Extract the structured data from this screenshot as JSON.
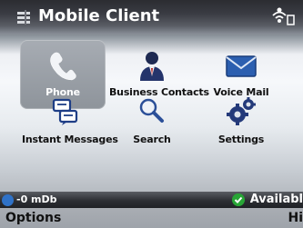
{
  "title_bar": {
    "title": "Mobile Client",
    "app_icon": "apps-grid-icon",
    "signal_icon": "wireless-signal-icon"
  },
  "menu": {
    "tiles": [
      {
        "label": "Phone",
        "icon": "phone-handset-icon",
        "selected": true
      },
      {
        "label": "Business Contacts",
        "icon": "contacts-person-icon",
        "selected": false
      },
      {
        "label": "Voice Mail",
        "icon": "envelope-icon",
        "selected": false
      },
      {
        "label": "Instant Messages",
        "icon": "chat-bubbles-icon",
        "selected": false
      },
      {
        "label": "Search",
        "icon": "magnifier-icon",
        "selected": false
      },
      {
        "label": "Settings",
        "icon": "gears-icon",
        "selected": false
      }
    ]
  },
  "status_bar": {
    "signal_level": "-0 mDb",
    "presence": "Availabl"
  },
  "softkeys": {
    "left": "Options",
    "right": "Hi"
  },
  "colors": {
    "title_text": "#ffffff",
    "selected_tile": "#9aa0a8",
    "status_blue": "#2f72c8",
    "available_green": "#28a536"
  }
}
